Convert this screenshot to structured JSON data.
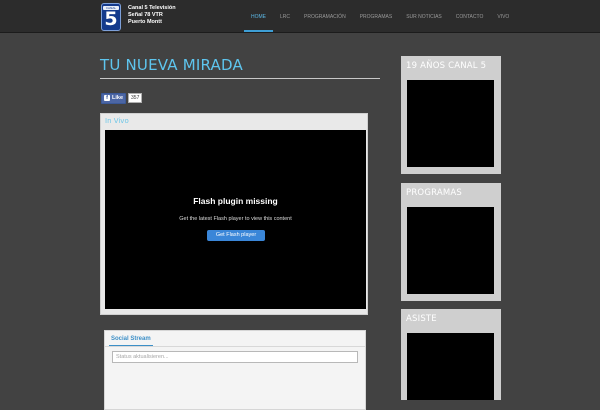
{
  "header": {
    "logo_badge": "CANAL",
    "logo_number": "5",
    "brand_lines": [
      "Canal 5 Televisión",
      "Señal 78 VTR",
      "Puerto Montt"
    ],
    "nav": [
      {
        "label": "Home"
      },
      {
        "label": "LRC"
      },
      {
        "label": "Programación"
      },
      {
        "label": "Programas"
      },
      {
        "label": "Sur Noticias"
      },
      {
        "label": "Contacto"
      },
      {
        "label": "Vivo"
      }
    ]
  },
  "main": {
    "title": "Tu Nueva Mirada",
    "like": {
      "label": "Like",
      "count": "357"
    },
    "player": {
      "label": "In Vivo",
      "missing_title": "Flash plugin missing",
      "missing_subtitle": "Get the latest Flash player to view this content",
      "button_label": "Get Flash player"
    },
    "social": {
      "tab_label": "Social Stream",
      "input_placeholder": "Status aktualisieren...",
      "input_value": ""
    }
  },
  "sidebar": [
    {
      "title": "19 Años Canal 5"
    },
    {
      "title": "Programas"
    },
    {
      "title": "Asiste"
    }
  ],
  "colors": {
    "accent": "#5ec5ee",
    "nav_active": "#3e9fd6",
    "background": "#424242",
    "header": "#2c2c2c"
  }
}
